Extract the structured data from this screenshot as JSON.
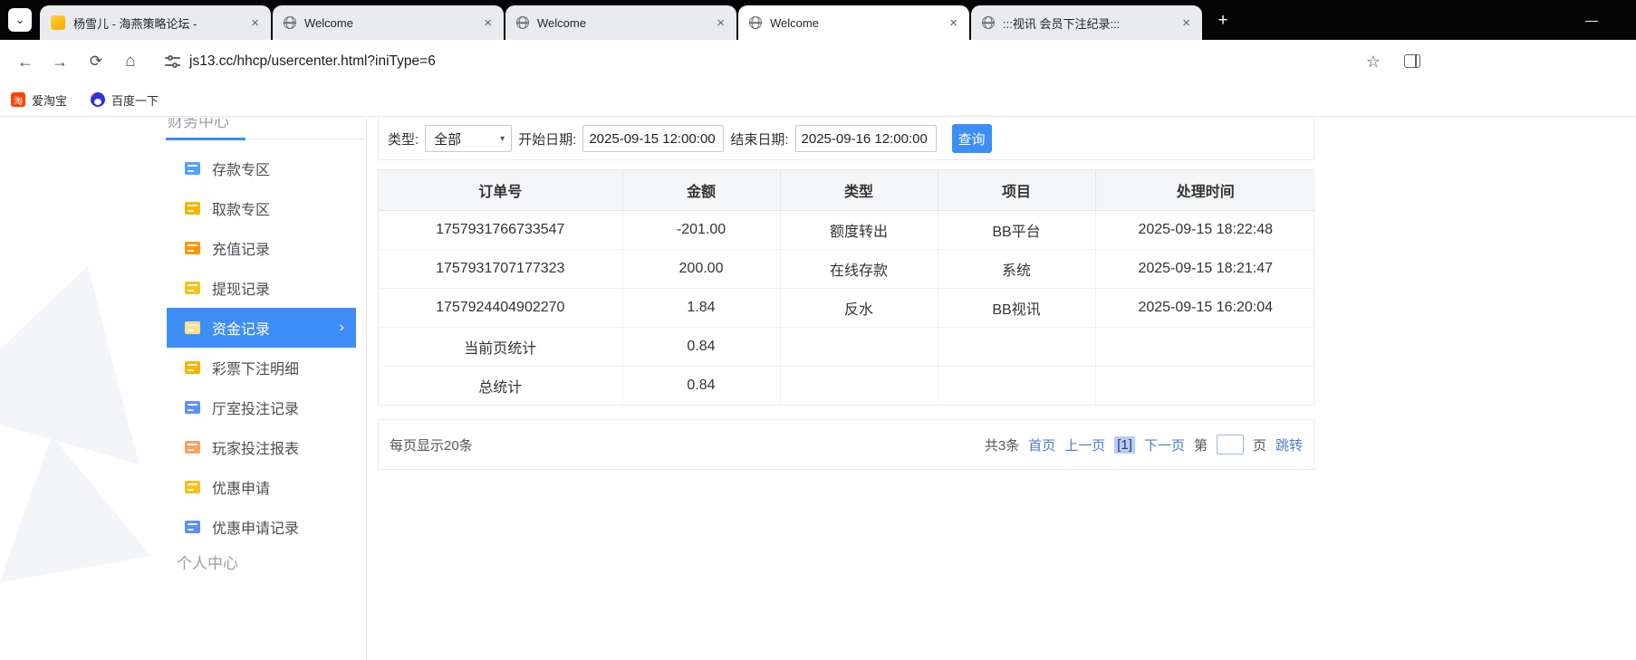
{
  "colors": {
    "accent": "#3e8ef7",
    "link": "#4a7bd4",
    "active_sidebar_bg": "#3e8ef7"
  },
  "icons": {
    "chevron_down": "⌄",
    "close_tab": "×",
    "new_tab": "+",
    "minimize": "—",
    "back": "←",
    "forward": "→",
    "reload": "⟳",
    "home": "⌂",
    "star": "☆",
    "select_arrow": "▾",
    "active_item_chevron": "›"
  },
  "browser": {
    "tabs": [
      {
        "title": "杨雪儿 - 海燕策略论坛 -",
        "active": false
      },
      {
        "title": "Welcome",
        "active": false
      },
      {
        "title": "Welcome",
        "active": false
      },
      {
        "title": "Welcome",
        "active": true
      },
      {
        "title": ":::视讯 会员下注纪录:::",
        "active": false
      }
    ],
    "url": "js13.cc/hhcp/usercenter.html?iniType=6",
    "bookmarks": [
      {
        "label": "爱淘宝",
        "icon_glyph": "淘"
      },
      {
        "label": "百度一下"
      }
    ]
  },
  "sidebar": {
    "section_top": "财务中心",
    "items": [
      {
        "label": "存款专区"
      },
      {
        "label": "取款专区"
      },
      {
        "label": "充值记录"
      },
      {
        "label": "提现记录"
      },
      {
        "label": "资金记录"
      },
      {
        "label": "彩票下注明细"
      },
      {
        "label": "厅室投注记录"
      },
      {
        "label": "玩家投注报表"
      },
      {
        "label": "优惠申请"
      },
      {
        "label": "优惠申请记录"
      }
    ],
    "section_bottom": "个人中心"
  },
  "filters": {
    "type_label": "类型:",
    "type_value": "全部",
    "start_label": "开始日期:",
    "start_value": "2025-09-15 12:00:00",
    "end_label": "结束日期:",
    "end_value": "2025-09-16 12:00:00",
    "search_button": "查询"
  },
  "table": {
    "headers": [
      "订单号",
      "金额",
      "类型",
      "项目",
      "处理时间"
    ],
    "rows": [
      [
        "1757931766733547",
        "-201.00",
        "额度转出",
        "BB平台",
        "2025-09-15 18:22:48"
      ],
      [
        "1757931707177323",
        "200.00",
        "在线存款",
        "系统",
        "2025-09-15 18:21:47"
      ],
      [
        "1757924404902270",
        "1.84",
        "反水",
        "BB视讯",
        "2025-09-15 16:20:04"
      ],
      [
        "当前页统计",
        "0.84",
        "",
        "",
        ""
      ],
      [
        "总统计",
        "0.84",
        "",
        "",
        ""
      ]
    ]
  },
  "pagination": {
    "page_size_text": "每页显示20条",
    "total_text": "共3条",
    "first": "首页",
    "prev": "上一页",
    "current_page": "[1]",
    "next": "下一页",
    "jump_pre": "第",
    "jump_post": "页",
    "jump_action": "跳转",
    "jump_value": ""
  }
}
